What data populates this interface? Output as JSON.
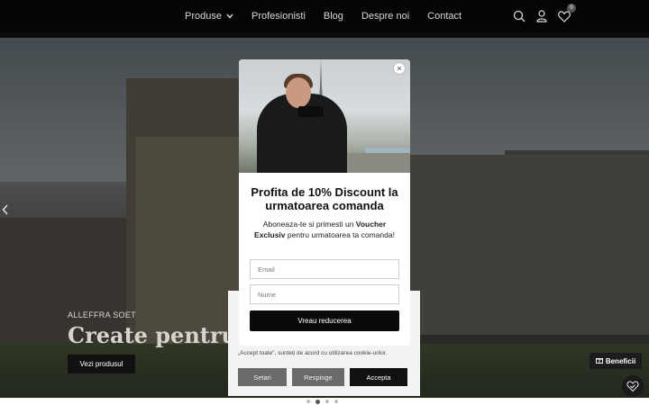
{
  "nav": {
    "items": [
      {
        "label": "Produse",
        "has_dropdown": true
      },
      {
        "label": "Profesionisti"
      },
      {
        "label": "Blog"
      },
      {
        "label": "Despre noi"
      },
      {
        "label": "Contact"
      }
    ],
    "icons": [
      "search-icon",
      "user-icon",
      "wishlist-heart-icon"
    ],
    "cart_count": "0"
  },
  "hero": {
    "brand": "ALLEFFRA SOET",
    "title": "Create pentru tin",
    "button_label": "Vezi produsul",
    "slide_count": 4,
    "active_slide": 2
  },
  "popup": {
    "title": "Profita de 10% Discount la urmatoarea comanda",
    "desc_pre": "Aboneaza-te si primesti un ",
    "desc_bold": "Voucher Exclusiv",
    "desc_post": " pentru urmatoarea ta comanda!",
    "email_placeholder": "Email",
    "name_placeholder": "Nume",
    "submit_label": "Vreau reducerea",
    "close_label": "×"
  },
  "cookie": {
    "text": "„Accept toate”, sunteți de acord cu utilizarea cookie-urilor.",
    "setari_label": "Setari",
    "respinge_label": "Respinge",
    "accepta_label": "Accepta"
  },
  "beneficii": {
    "label": "Beneficii"
  },
  "colors": {
    "nav_bg": "#050505",
    "accent_dark": "#0a0a0a"
  }
}
